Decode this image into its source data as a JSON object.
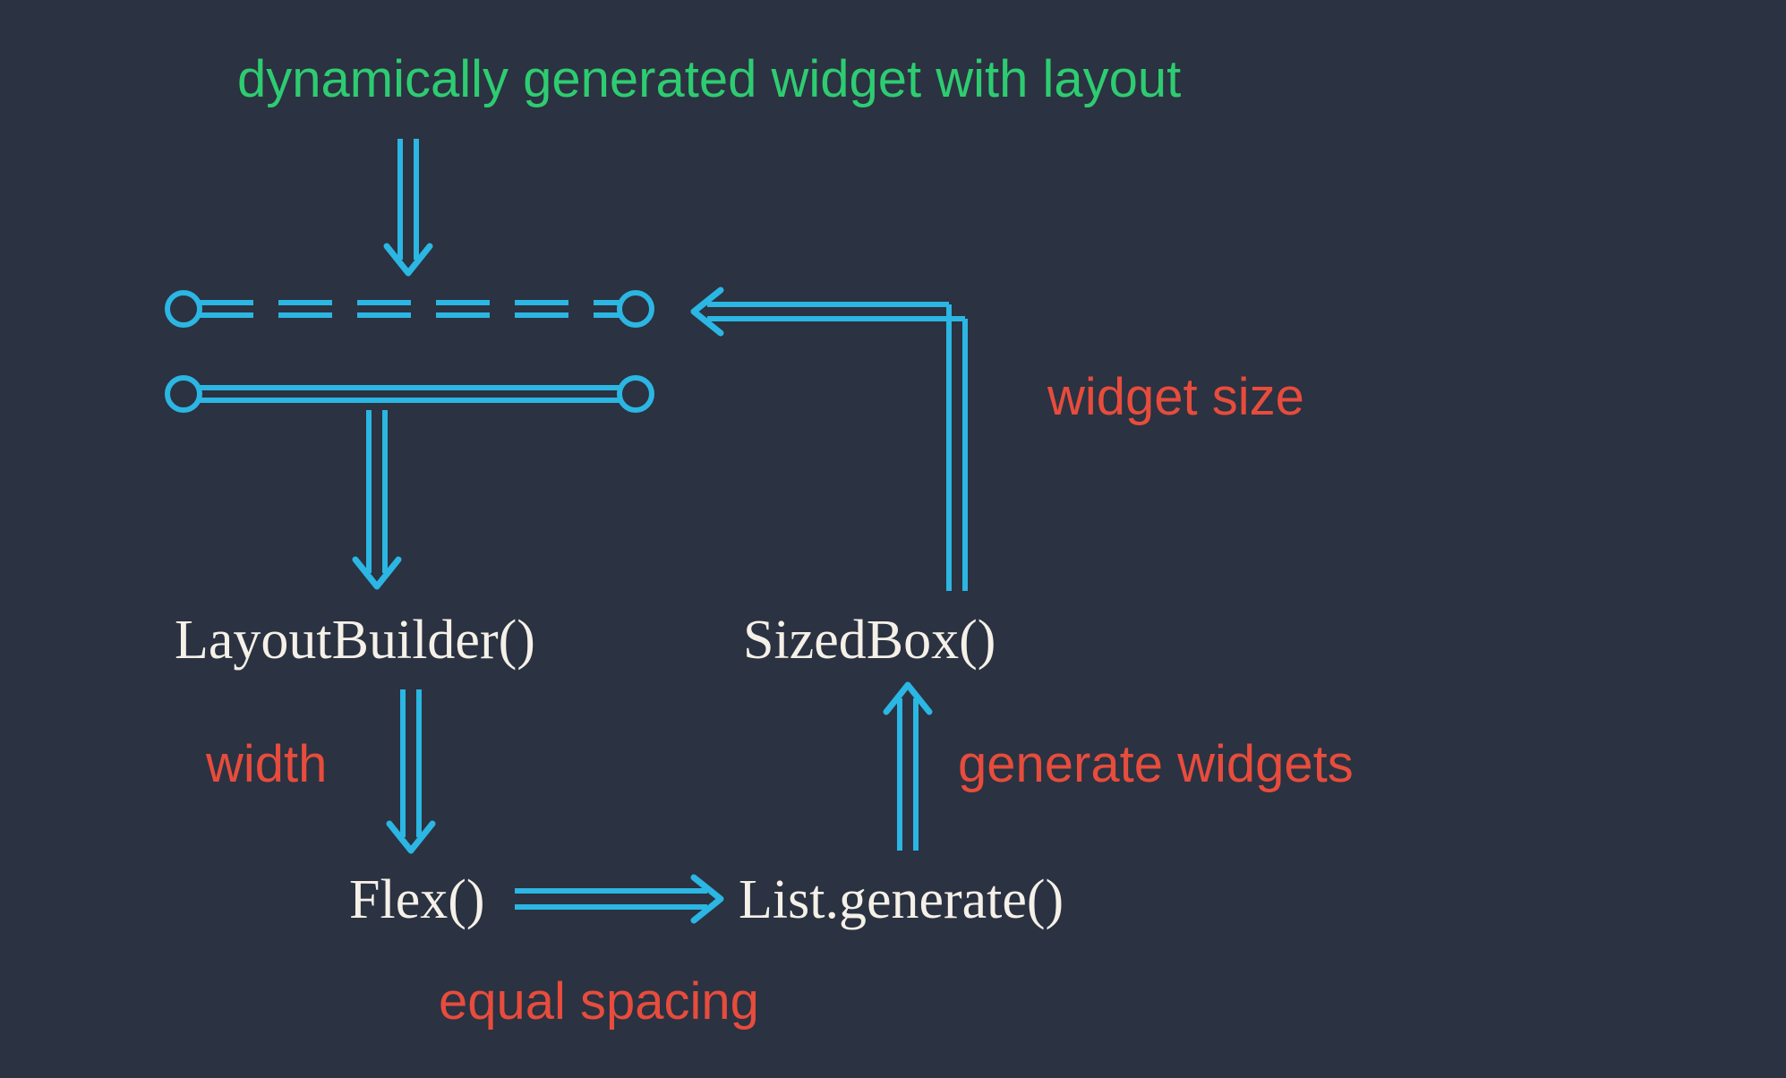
{
  "title": "dynamically generated widget with layout",
  "nodes": {
    "layout_builder": "LayoutBuilder()",
    "sized_box": "SizedBox()",
    "flex": "Flex()",
    "list_generate": "List.generate()"
  },
  "edges": {
    "width": "width",
    "equal_spacing": "equal spacing",
    "generate_widgets": "generate widgets",
    "widget_size": "widget size"
  },
  "colors": {
    "bg": "#2b3241",
    "arrow": "#2bb6e3",
    "green": "#2ecc71",
    "red": "#e74c3c",
    "white": "#f5f0e8"
  }
}
